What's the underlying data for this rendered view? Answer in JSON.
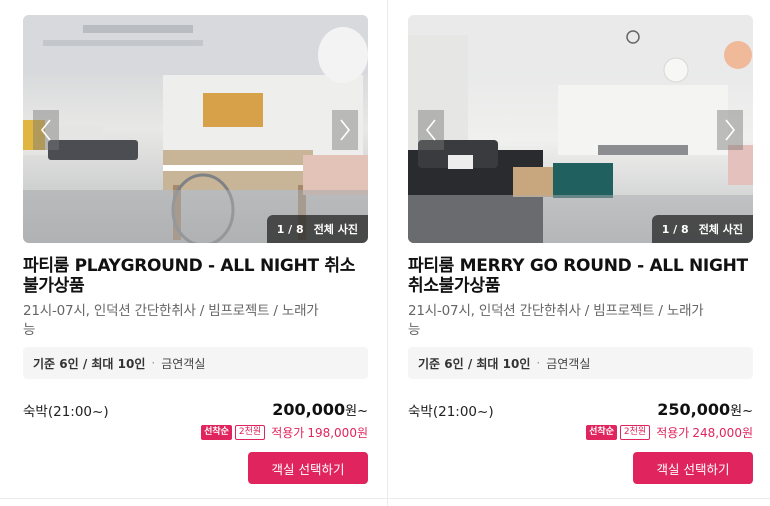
{
  "rooms": [
    {
      "title": "파티룸 PLAYGROUND - ALL NIGHT 취소불가상품",
      "title_line1": "파티룸 PLAYGROUND - ALL NIGHT 취소",
      "title_line2": "불가상품",
      "desc_line1": "21시-07시, 인덕션 간단한취사 / 빔프로젝트 / 노래가",
      "desc_line2": "능",
      "photo_index": "1 / 8",
      "photo_all_label": "전체 사진",
      "capacity": "기준 6인 / 최대 10인",
      "no_smoking": "금연객실",
      "stay_label": "숙박(21:00~)",
      "price": "200,000",
      "price_unit": "원~",
      "first_badge": "선착순",
      "first_amount": "2천원",
      "discount_label": "적용가",
      "discount_price": "198,000원",
      "button_label": "객실 선택하기"
    },
    {
      "title": "파티룸 MERRY GO ROUND - ALL NIGHT 취소불가상품",
      "title_line1": "파티룸 MERRY GO ROUND - ALL NIGHT",
      "title_line2": "취소불가상품",
      "desc_line1": "21시-07시, 인덕션 간단한취사 / 빔프로젝트 / 노래가",
      "desc_line2": "능",
      "photo_index": "1 / 8",
      "photo_all_label": "전체 사진",
      "capacity": "기준 6인 / 최대 10인",
      "no_smoking": "금연객실",
      "stay_label": "숙박(21:00~)",
      "price": "250,000",
      "price_unit": "원~",
      "first_badge": "선착순",
      "first_amount": "2천원",
      "discount_label": "적용가",
      "discount_price": "248,000원",
      "button_label": "객실 선택하기"
    }
  ],
  "icons": {
    "prev": "chevron-left-icon",
    "next": "chevron-right-icon"
  },
  "colors": {
    "accent": "#e0245e",
    "info_bg": "#f5f5f5"
  }
}
